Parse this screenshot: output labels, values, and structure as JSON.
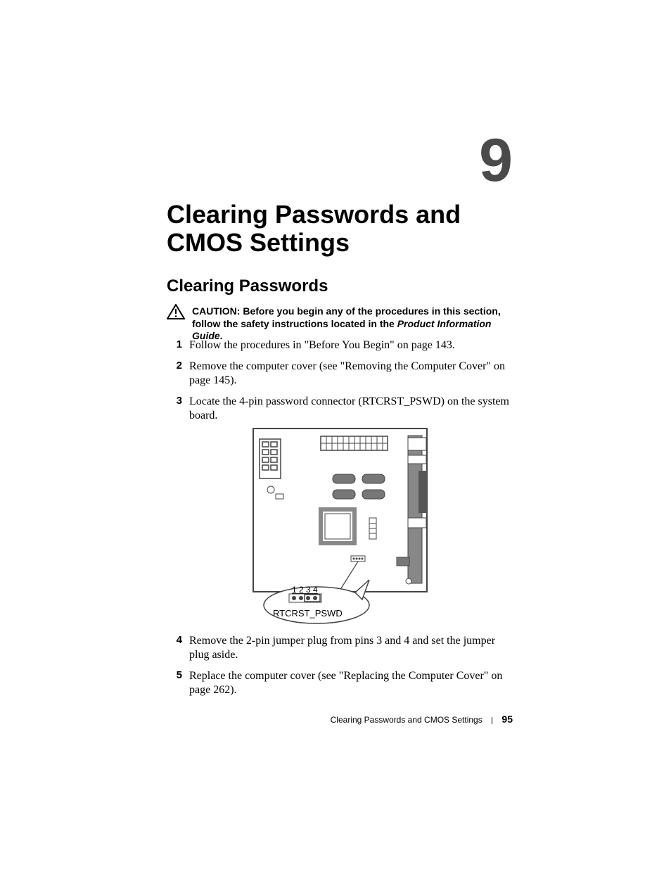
{
  "chapter": {
    "number": "9",
    "title": "Clearing Passwords and CMOS Settings"
  },
  "section": {
    "title": "Clearing Passwords"
  },
  "caution": {
    "label": "CAUTION:",
    "text_before": " Before you begin any of the procedures in this section, follow the safety instructions located in the ",
    "pig": "Product Information Guide",
    "trail": "."
  },
  "steps_a": [
    {
      "n": "1",
      "text": "Follow the procedures in \"Before You Begin\" on page 143."
    },
    {
      "n": "2",
      "text": "Remove the computer cover (see \"Removing the Computer Cover\" on page 145)."
    },
    {
      "n": "3",
      "text": "Locate the 4-pin password connector (RTCRST_PSWD) on the system board."
    }
  ],
  "steps_b": [
    {
      "n": "4",
      "text": "Remove the 2-pin jumper plug from pins 3 and 4 and set the jumper plug aside."
    },
    {
      "n": "5",
      "text": "Replace the computer cover (see \"Replacing the Computer Cover\" on page 262)."
    }
  ],
  "figure": {
    "jumper_pins": "1 2 3 4",
    "jumper_label": "RTCRST_PSWD"
  },
  "footer": {
    "section": "Clearing Passwords and CMOS Settings",
    "page": "95"
  }
}
